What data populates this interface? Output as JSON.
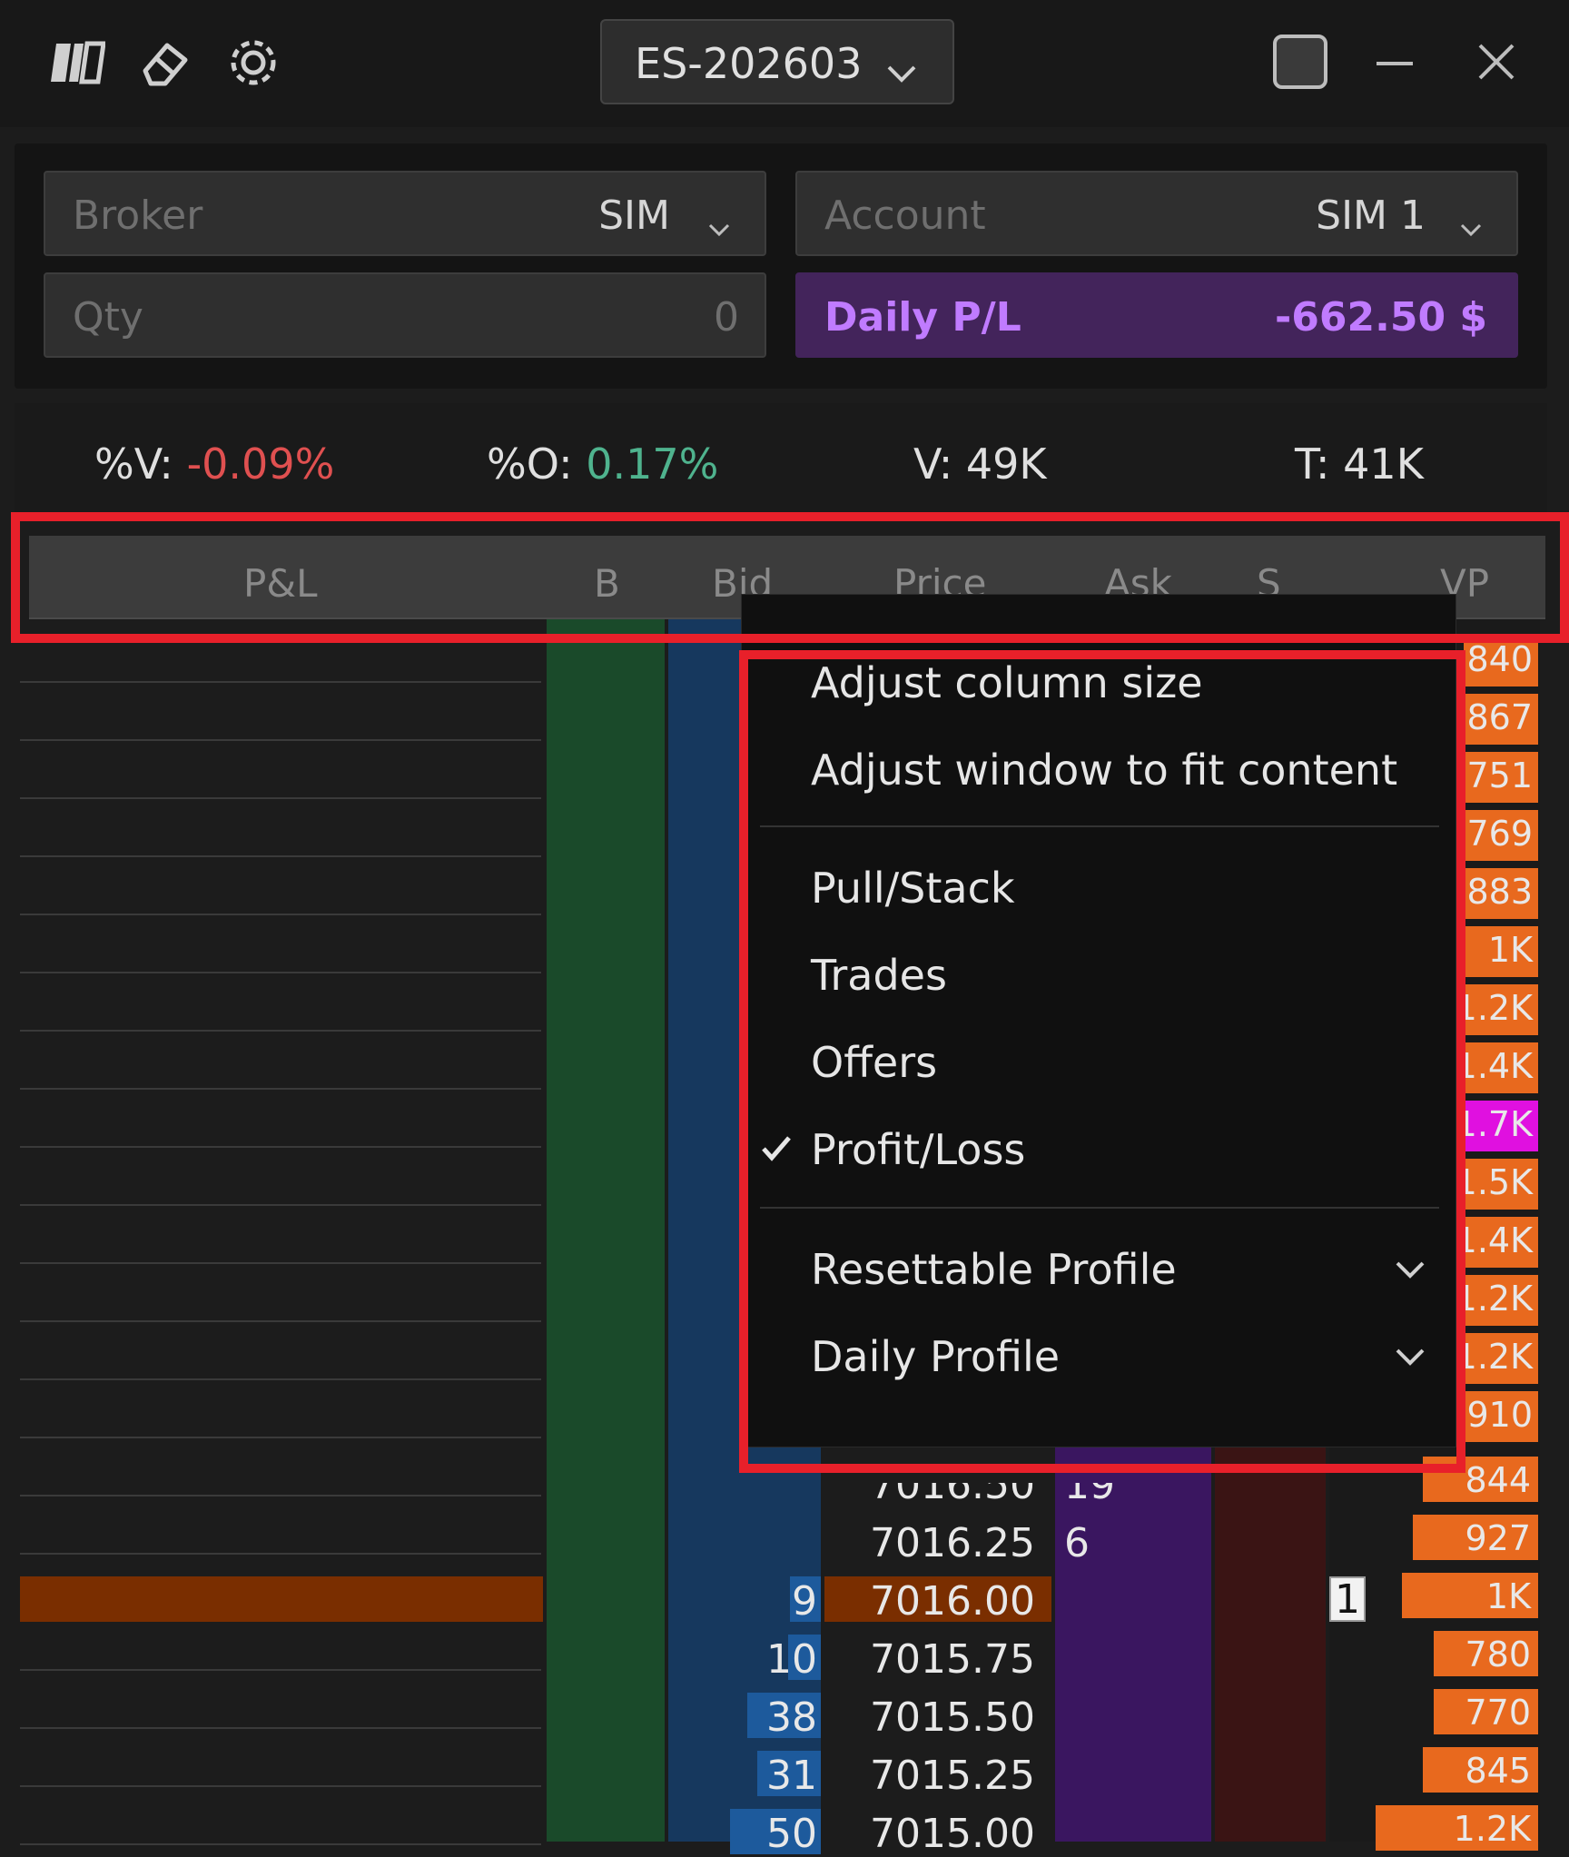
{
  "toolbar": {
    "symbol": "ES-202603",
    "icons": [
      "dom-logo-icon",
      "eraser-icon",
      "gear-icon",
      "dropdown-chevron-icon",
      "window-mode-icon",
      "minimize-icon",
      "close-icon"
    ]
  },
  "account_panel": {
    "broker_label": "Broker",
    "broker_value": "SIM",
    "account_label": "Account",
    "account_value": "SIM 1",
    "qty_label": "Qty",
    "qty_value": "0",
    "daily_pl_label": "Daily P/L",
    "daily_pl_value": "-662.50 $"
  },
  "stats": {
    "v_pct_label": "%V:",
    "v_pct_value": "-0.09%",
    "o_pct_label": "%O:",
    "o_pct_value": "0.17%",
    "volume": "V: 49K",
    "trades": "T: 41K"
  },
  "columns": [
    "P&L",
    "B",
    "Bid",
    "Price",
    "Ask",
    "S",
    "VP"
  ],
  "context_menu": {
    "items": [
      {
        "label": "Adjust column size"
      },
      {
        "label": "Adjust window to fit content"
      },
      {
        "label": "Pull/Stack"
      },
      {
        "label": "Trades"
      },
      {
        "label": "Offers"
      },
      {
        "label": "Profit/Loss",
        "checked": true
      },
      {
        "label": "Resettable Profile",
        "submenu": true
      },
      {
        "label": "Daily Profile",
        "submenu": true
      }
    ]
  },
  "ladder_rows": [
    {
      "price": "7016.50",
      "bid": "",
      "ask": "19",
      "vp": "844",
      "vp_frac": 0.55
    },
    {
      "price": "7016.25",
      "bid": "",
      "ask": "6",
      "vp": "927",
      "vp_frac": 0.6
    },
    {
      "price": "7016.00",
      "bid": "9",
      "ask": "",
      "vp": "1K",
      "vp_frac": 0.65,
      "current": true,
      "s_marker": "1"
    },
    {
      "price": "7015.75",
      "bid": "10",
      "ask": "",
      "vp": "780",
      "vp_frac": 0.5
    },
    {
      "price": "7015.50",
      "bid": "38",
      "ask": "",
      "vp": "770",
      "vp_frac": 0.5
    },
    {
      "price": "7015.25",
      "bid": "31",
      "ask": "",
      "vp": "845",
      "vp_frac": 0.55
    },
    {
      "price": "7015.00",
      "bid": "50",
      "ask": "",
      "vp": "1.2K",
      "vp_frac": 0.78
    }
  ],
  "vp_upper": [
    "840",
    "867",
    "751",
    "769",
    "883",
    "1K",
    "1.2K",
    "1.4K",
    "1.7K",
    "1.5K",
    "1.4K",
    "1.2K",
    "1.2K",
    "910"
  ],
  "colors": {
    "bid_column": "#1a4a2a",
    "bid_bar": "#1d5a9c",
    "ask_column": "#3a1660",
    "sell_column": "#3a1414",
    "vp_bar": "#e8691e",
    "vp_max": "#e010e0",
    "current_price_row": "#7a2e00",
    "highlight_box": "#e8202a"
  }
}
